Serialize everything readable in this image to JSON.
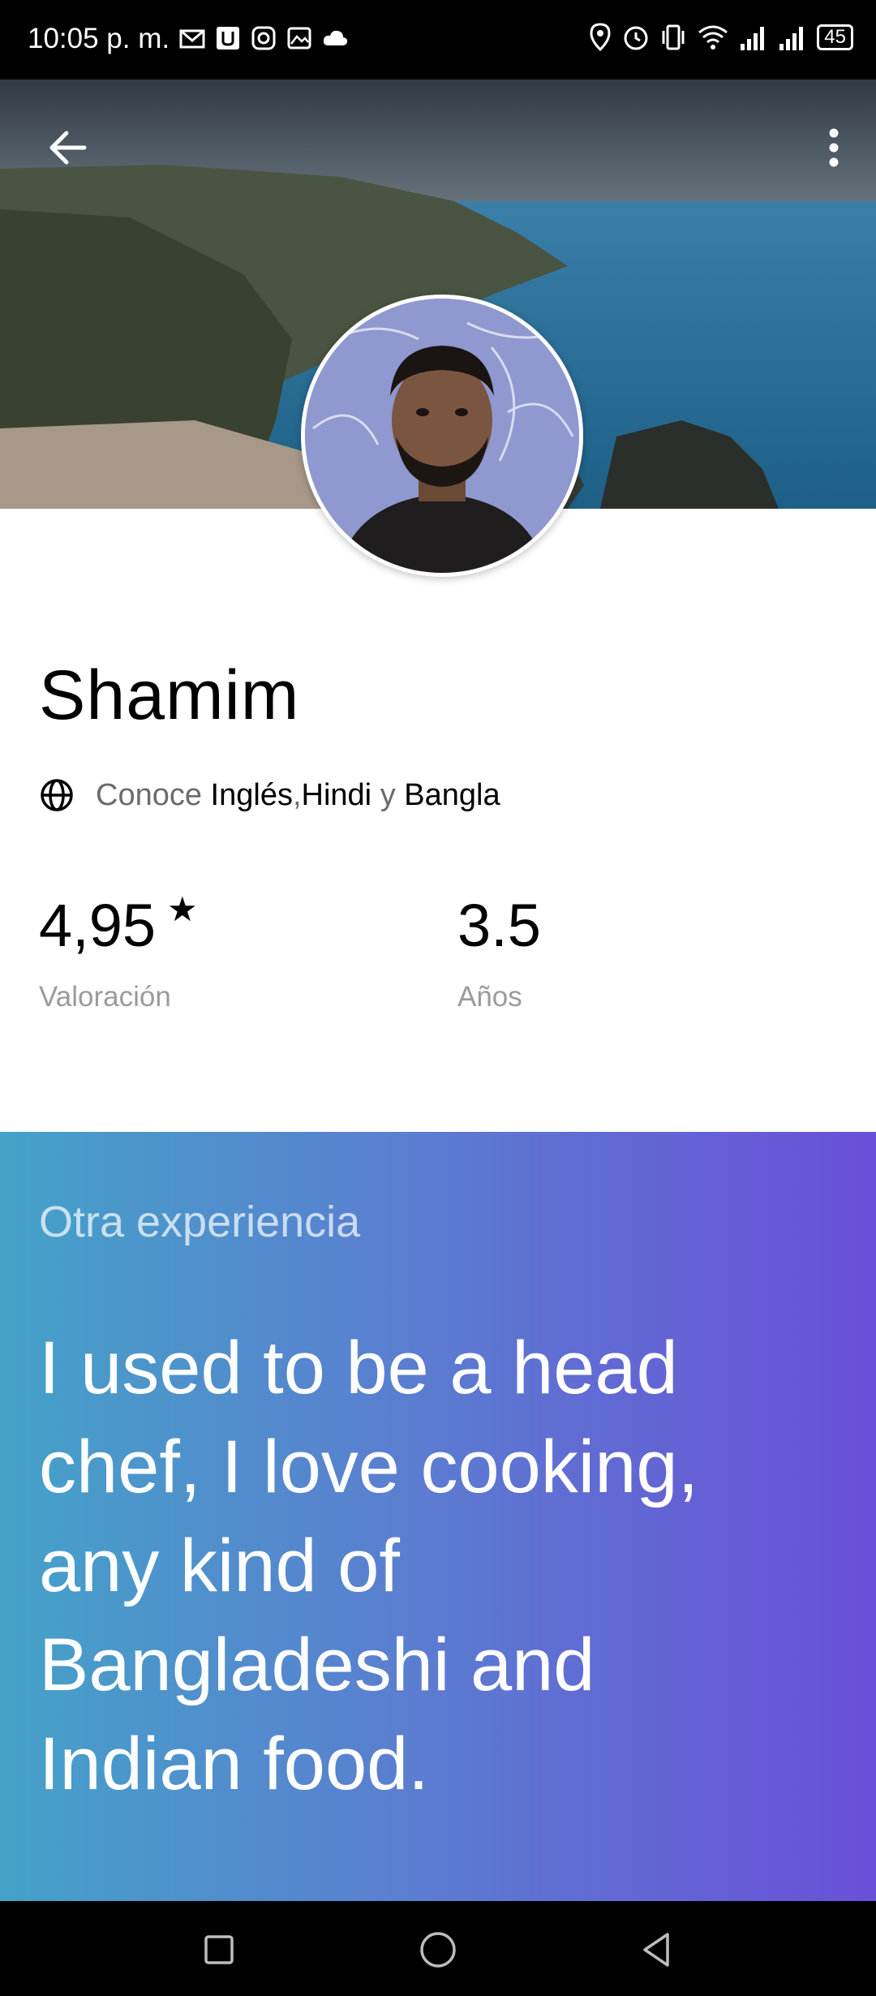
{
  "status_bar": {
    "time": "10:05 p. m.",
    "battery": "45"
  },
  "profile": {
    "name": "Shamim",
    "languages_prefix": "Conoce ",
    "languages": [
      "Inglés",
      "Hindi",
      "Bangla"
    ],
    "lang_sep_comma": ", ",
    "lang_sep_and": " y "
  },
  "stats": {
    "rating_value": "4,95",
    "rating_star": "★",
    "rating_label": "Valoración",
    "years_value": "3.5",
    "years_label": "Años"
  },
  "about": {
    "label": "Otra experiencia",
    "text": "I used to be a head chef, I love cooking, any kind of Bangladeshi and Indian food."
  },
  "colors": {
    "gradient_start": "#44a2c8",
    "gradient_end": "#6a4fd8",
    "muted_text": "#6b6b6b"
  },
  "icons": [
    "back-arrow-icon",
    "more-vert-icon",
    "globe-icon",
    "star-icon",
    "nav-recents-icon",
    "nav-home-icon",
    "nav-back-icon"
  ]
}
